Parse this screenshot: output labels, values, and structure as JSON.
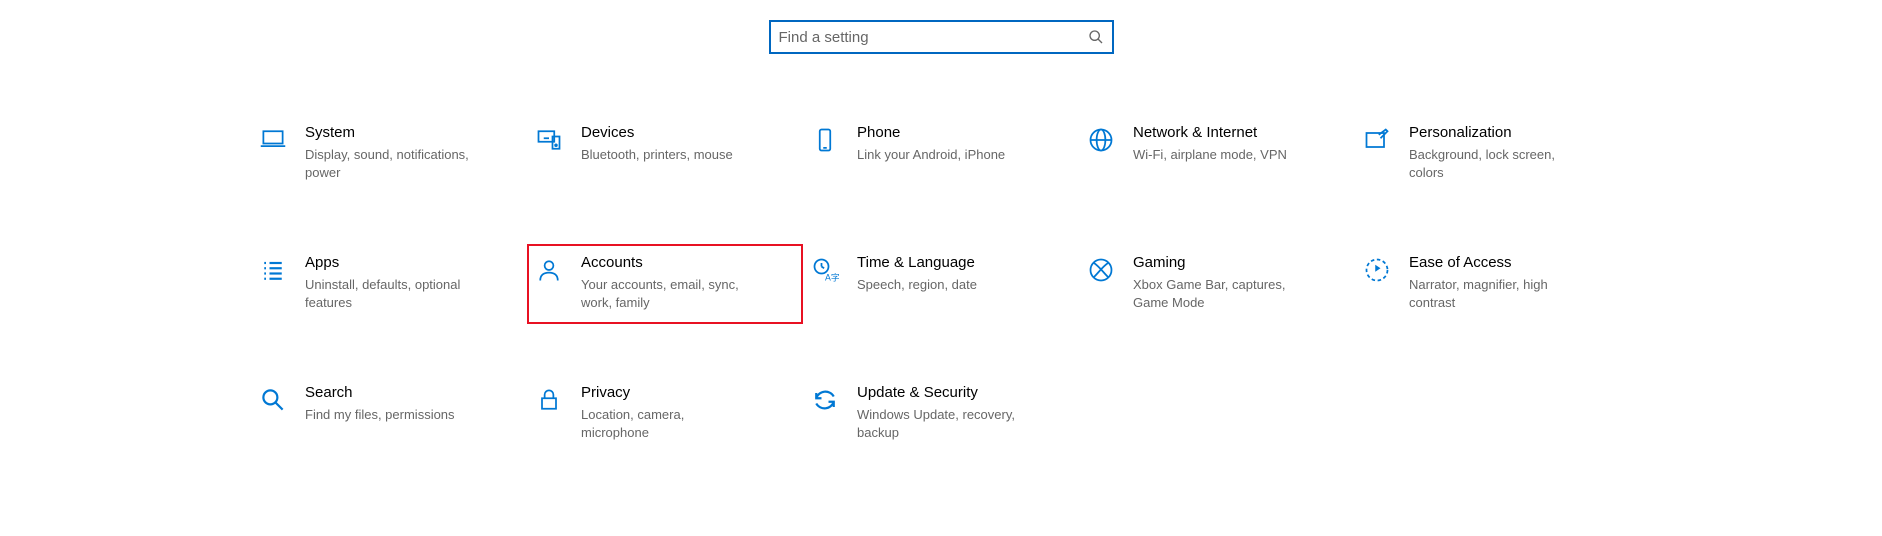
{
  "search": {
    "placeholder": "Find a setting"
  },
  "tiles": {
    "system": {
      "title": "System",
      "sub": "Display, sound, notifications, power"
    },
    "devices": {
      "title": "Devices",
      "sub": "Bluetooth, printers, mouse"
    },
    "phone": {
      "title": "Phone",
      "sub": "Link your Android, iPhone"
    },
    "network": {
      "title": "Network & Internet",
      "sub": "Wi-Fi, airplane mode, VPN"
    },
    "personalization": {
      "title": "Personalization",
      "sub": "Background, lock screen, colors"
    },
    "apps": {
      "title": "Apps",
      "sub": "Uninstall, defaults, optional features"
    },
    "accounts": {
      "title": "Accounts",
      "sub": "Your accounts, email, sync, work, family"
    },
    "time": {
      "title": "Time & Language",
      "sub": "Speech, region, date"
    },
    "gaming": {
      "title": "Gaming",
      "sub": "Xbox Game Bar, captures, Game Mode"
    },
    "ease": {
      "title": "Ease of Access",
      "sub": "Narrator, magnifier, high contrast"
    },
    "search": {
      "title": "Search",
      "sub": "Find my files, permissions"
    },
    "privacy": {
      "title": "Privacy",
      "sub": "Location, camera, microphone"
    },
    "update": {
      "title": "Update & Security",
      "sub": "Windows Update, recovery, backup"
    }
  },
  "highlighted": "accounts"
}
